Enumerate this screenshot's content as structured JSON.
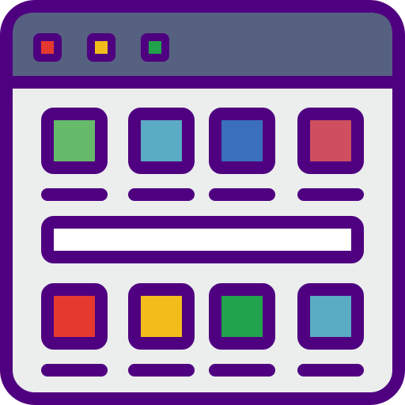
{
  "colors": {
    "outline": "#4f0080",
    "titlebar": "#566080",
    "window_bg": "#ebeeed",
    "search_fill": "#ffffff",
    "dot_red": "#e53930",
    "dot_yellow": "#f2bd1a",
    "dot_green": "#21a24c"
  },
  "window_controls": [
    {
      "name": "close-dot",
      "color": "#e53930"
    },
    {
      "name": "minimize-dot",
      "color": "#f2bd1a"
    },
    {
      "name": "maximize-dot",
      "color": "#21a24c"
    }
  ],
  "tiles_row_1": [
    {
      "color": "#66bb6a"
    },
    {
      "color": "#5aabc4"
    },
    {
      "color": "#3a6fbd"
    },
    {
      "color": "#cf4e60"
    }
  ],
  "tiles_row_2": [
    {
      "color": "#e53930"
    },
    {
      "color": "#f2bd1a"
    },
    {
      "color": "#21a24c"
    },
    {
      "color": "#5aabc4"
    }
  ]
}
